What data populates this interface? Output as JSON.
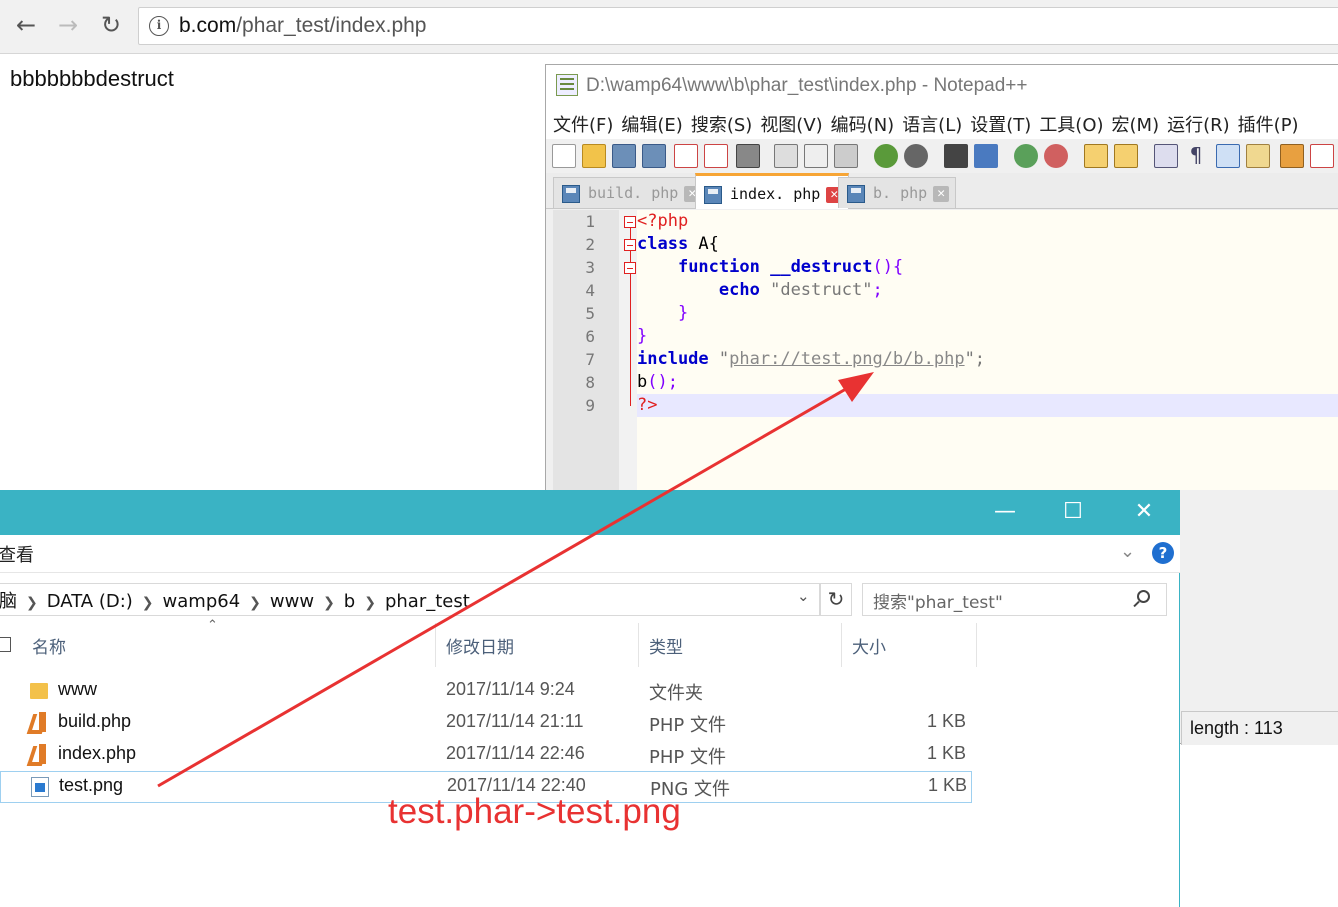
{
  "browser": {
    "url_host": "b.com",
    "url_path": "/phar_test/index.php",
    "page_output": "bbbbbbbdestruct"
  },
  "npp": {
    "title": "D:\\wamp64\\www\\b\\phar_test\\index.php - Notepad++",
    "menu": [
      "文件(F)",
      "编辑(E)",
      "搜索(S)",
      "视图(V)",
      "编码(N)",
      "语言(L)",
      "设置(T)",
      "工具(O)",
      "宏(M)",
      "运行(R)",
      "插件(P)"
    ],
    "tabs": [
      {
        "label": "build. php",
        "active": false
      },
      {
        "label": "index. php",
        "active": true
      },
      {
        "label": "b. php",
        "active": false
      }
    ],
    "line_numbers": [
      "1",
      "2",
      "3",
      "4",
      "5",
      "6",
      "7",
      "8",
      "9"
    ],
    "code": {
      "l1": "<?php",
      "l2_kw": "class",
      "l2_rest": " A{",
      "l3_kw": "function",
      "l3_name": "__destruct",
      "l3_rest": "(){",
      "l4_kw": "echo",
      "l4_str": "\"destruct\"",
      "l4_end": ";",
      "l5": "}",
      "l6": "}",
      "l7_kw": "include",
      "l7_q1": "\"",
      "l7_link": "phar://test.png/b/b.php",
      "l7_q2": "\";",
      "l8_fn": "b",
      "l8_rest": "();",
      "l9": "?>"
    },
    "status_length": "length : 113"
  },
  "explorer": {
    "ribbon_view": "查看",
    "breadcrumb": [
      "脑",
      "DATA (D:)",
      "wamp64",
      "www",
      "b",
      "phar_test"
    ],
    "search_placeholder": "搜索\"phar_test\"",
    "columns": {
      "name": "名称",
      "date": "修改日期",
      "type": "类型",
      "size": "大小"
    },
    "files": [
      {
        "name": "www",
        "date": "2017/11/14 9:24",
        "type": "文件夹",
        "size": "",
        "icon": "folder-icon"
      },
      {
        "name": "build.php",
        "date": "2017/11/14 21:11",
        "type": "PHP 文件",
        "size": "1 KB",
        "icon": "php-file-icon"
      },
      {
        "name": "index.php",
        "date": "2017/11/14 22:46",
        "type": "PHP 文件",
        "size": "1 KB",
        "icon": "php-file-icon"
      },
      {
        "name": "test.png",
        "date": "2017/11/14 22:40",
        "type": "PNG 文件",
        "size": "1 KB",
        "icon": "png-file-icon"
      }
    ]
  },
  "annotation": "test.phar->test.png",
  "colors": {
    "accent_teal": "#3ab3c4",
    "annotation_red": "#e83232",
    "keyword_blue": "#0000cc",
    "php_tag_red": "#e02020"
  }
}
